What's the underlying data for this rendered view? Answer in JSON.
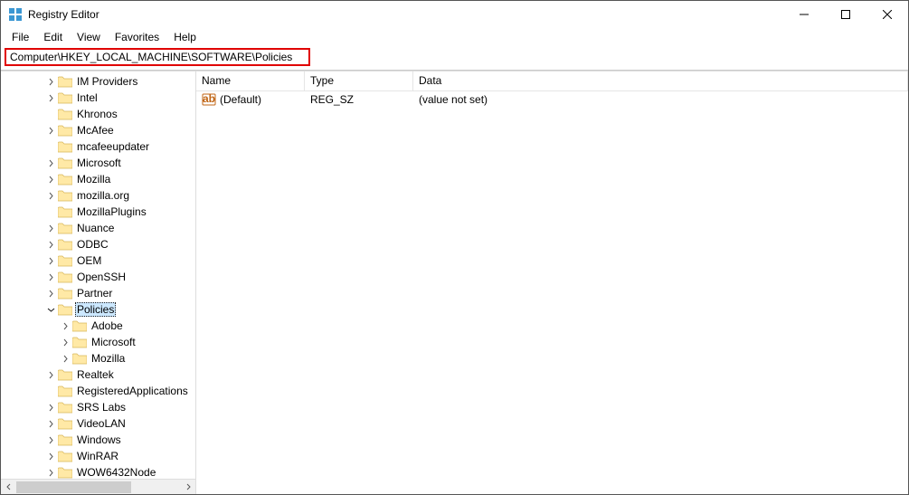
{
  "window": {
    "title": "Registry Editor"
  },
  "menu": {
    "file": "File",
    "edit": "Edit",
    "view": "View",
    "favorites": "Favorites",
    "help": "Help"
  },
  "address": "Computer\\HKEY_LOCAL_MACHINE\\SOFTWARE\\Policies",
  "tree": {
    "items": [
      {
        "indent": 3,
        "exp": ">",
        "label": "IM Providers"
      },
      {
        "indent": 3,
        "exp": ">",
        "label": "Intel"
      },
      {
        "indent": 3,
        "exp": "",
        "label": "Khronos"
      },
      {
        "indent": 3,
        "exp": ">",
        "label": "McAfee"
      },
      {
        "indent": 3,
        "exp": "",
        "label": "mcafeeupdater"
      },
      {
        "indent": 3,
        "exp": ">",
        "label": "Microsoft"
      },
      {
        "indent": 3,
        "exp": ">",
        "label": "Mozilla"
      },
      {
        "indent": 3,
        "exp": ">",
        "label": "mozilla.org"
      },
      {
        "indent": 3,
        "exp": "",
        "label": "MozillaPlugins"
      },
      {
        "indent": 3,
        "exp": ">",
        "label": "Nuance"
      },
      {
        "indent": 3,
        "exp": ">",
        "label": "ODBC"
      },
      {
        "indent": 3,
        "exp": ">",
        "label": "OEM"
      },
      {
        "indent": 3,
        "exp": ">",
        "label": "OpenSSH"
      },
      {
        "indent": 3,
        "exp": ">",
        "label": "Partner"
      },
      {
        "indent": 3,
        "exp": "v",
        "label": "Policies",
        "selected": true
      },
      {
        "indent": 4,
        "exp": ">",
        "label": "Adobe"
      },
      {
        "indent": 4,
        "exp": ">",
        "label": "Microsoft"
      },
      {
        "indent": 4,
        "exp": ">",
        "label": "Mozilla"
      },
      {
        "indent": 3,
        "exp": ">",
        "label": "Realtek"
      },
      {
        "indent": 3,
        "exp": "",
        "label": "RegisteredApplications"
      },
      {
        "indent": 3,
        "exp": ">",
        "label": "SRS Labs"
      },
      {
        "indent": 3,
        "exp": ">",
        "label": "VideoLAN"
      },
      {
        "indent": 3,
        "exp": ">",
        "label": "Windows"
      },
      {
        "indent": 3,
        "exp": ">",
        "label": "WinRAR"
      },
      {
        "indent": 3,
        "exp": ">",
        "label": "WOW6432Node"
      }
    ]
  },
  "list": {
    "columns": {
      "name": "Name",
      "type": "Type",
      "data": "Data"
    },
    "rows": [
      {
        "name": "(Default)",
        "type": "REG_SZ",
        "data": "(value not set)"
      }
    ]
  }
}
